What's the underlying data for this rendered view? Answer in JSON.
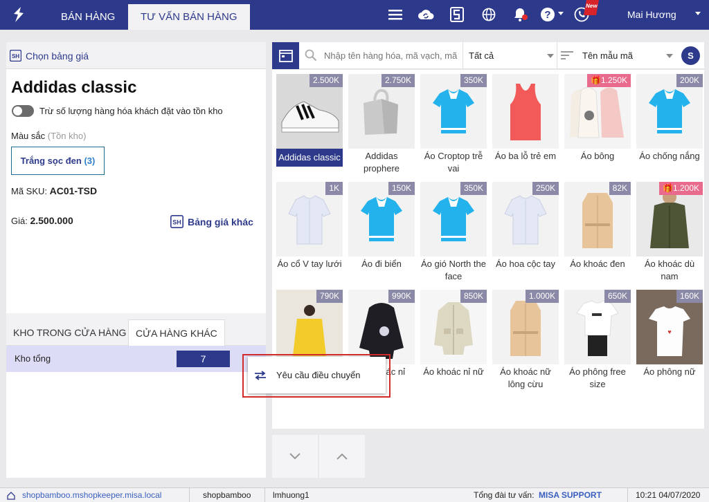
{
  "header": {
    "tabs": [
      {
        "label": "BÁN HÀNG"
      },
      {
        "label": "TƯ VẤN BÁN HÀNG"
      }
    ],
    "user_name": "Mai Hương",
    "new_badge": "New",
    "colors": {
      "primary": "#2d3a8c"
    }
  },
  "left": {
    "price_list_label": "Chọn bảng giá",
    "product_name": "Addidas classic",
    "toggle_label": "Trừ số lượng hàng hóa khách đặt vào tồn kho",
    "color_label": "Màu sắc",
    "color_sub": "(Tồn kho)",
    "variant_label": "Trắng sọc đen",
    "variant_count": "(3)",
    "sku_label": "Mã SKU:",
    "sku_value": "AC01-TSD",
    "price_label": "Giá:",
    "price_value": "2.500.000",
    "other_price_label": "Bảng giá khác",
    "stock_tabs": [
      "KHO TRONG CỬA HÀNG",
      "CỬA HÀNG KHÁC"
    ],
    "stock_row": {
      "name": "Kho tổng",
      "qty": "7"
    }
  },
  "context_menu": {
    "item": "Yêu cầu điều chuyển"
  },
  "search": {
    "placeholder": "Nhập tên hàng hóa, mã vạch, mã",
    "filter": "Tất cả",
    "sort": "Tên mẫu mã",
    "round_label": "S"
  },
  "products": [
    {
      "name": "Addidas classic",
      "badge": "2.500K"
    },
    {
      "name": "Addidas prophere",
      "badge": "2.750K"
    },
    {
      "name": "Áo Croptop trễ vai",
      "badge": "350K"
    },
    {
      "name": "Áo ba lỗ trẻ em",
      "badge": ""
    },
    {
      "name": "Áo bông",
      "badge": "1.250K"
    },
    {
      "name": "Áo chống nắng",
      "badge": "200K"
    },
    {
      "name": "Áo cổ V tay lưới",
      "badge": "1K"
    },
    {
      "name": "Áo đi biển",
      "badge": "150K"
    },
    {
      "name": "Áo gió North the face",
      "badge": "350K"
    },
    {
      "name": "Áo hoa cộc tay",
      "badge": "250K"
    },
    {
      "name": "Áo khoác đen",
      "badge": "82K"
    },
    {
      "name": "Áo khoác dù nam",
      "badge": "1.200K"
    },
    {
      "name": "",
      "badge": "790K"
    },
    {
      "name": "Áo khoác nỉ",
      "badge": "990K"
    },
    {
      "name": "Áo khoác nỉ nữ",
      "badge": "850K"
    },
    {
      "name": "Áo khoác nữ lông cừu",
      "badge": "1.000K"
    },
    {
      "name": "Áo phông free size",
      "badge": "650K"
    },
    {
      "name": "Áo phông nữ",
      "badge": "160K"
    }
  ],
  "status": {
    "domain": "shopbamboo.mshopkeeper.misa.local",
    "shop": "shopbamboo",
    "user": "lmhuong1",
    "hotline_label": "Tổng đài tư vấn:",
    "hotline_value": "MISA SUPPORT",
    "datetime": "10:21 04/07/2020"
  }
}
